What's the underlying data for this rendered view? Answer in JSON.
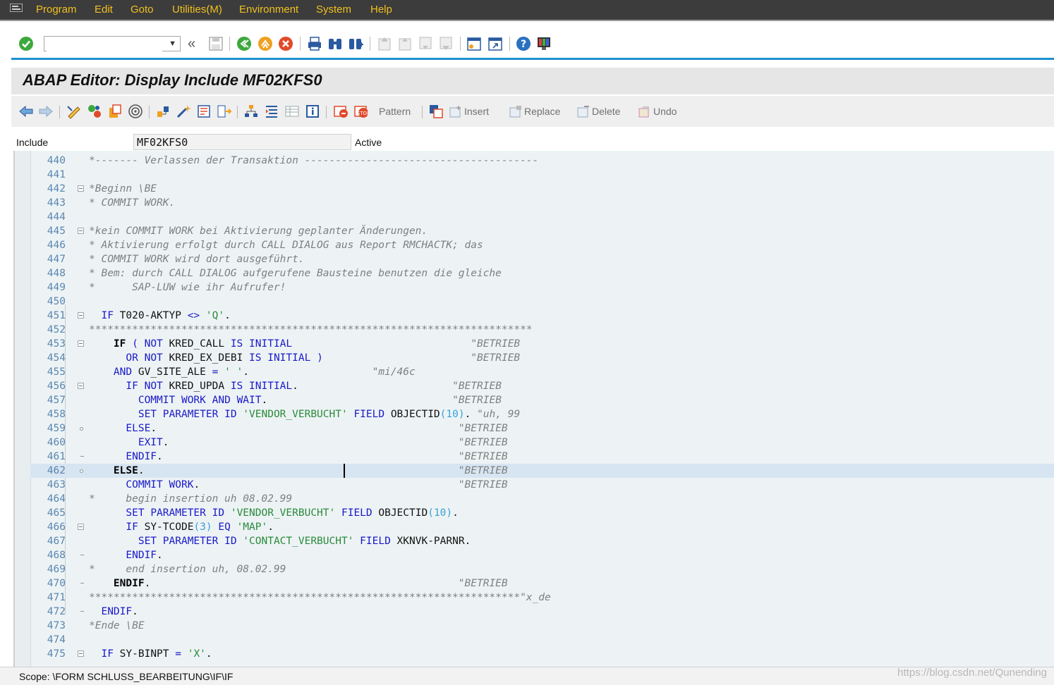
{
  "menu": {
    "items": [
      "Program",
      "Edit",
      "Goto",
      "Utilities(M)",
      "Environment",
      "System",
      "Help"
    ]
  },
  "toolbar": {
    "command_value": "",
    "command_placeholder": "",
    "expand_glyph": "«"
  },
  "title": "ABAP Editor: Display Include MF02KFS0",
  "app_toolbar": {
    "pattern": "Pattern",
    "insert": "Insert",
    "replace": "Replace",
    "delete": "Delete",
    "undo": "Undo"
  },
  "include": {
    "label": "Include",
    "value": "MF02KFS0",
    "status": "Active"
  },
  "editor": {
    "current_line": 462,
    "lines": [
      {
        "n": "440",
        "fold": "",
        "seg": [
          [
            "c",
            "*------- Verlassen der Transaktion --------------------------------------"
          ]
        ]
      },
      {
        "n": "441",
        "fold": "",
        "seg": []
      },
      {
        "n": "442",
        "fold": "box",
        "seg": [
          [
            "c",
            "*Beginn \\BE"
          ]
        ]
      },
      {
        "n": "443",
        "fold": "",
        "seg": [
          [
            "c",
            "* COMMIT WORK."
          ]
        ]
      },
      {
        "n": "444",
        "fold": "",
        "seg": []
      },
      {
        "n": "445",
        "fold": "box",
        "seg": [
          [
            "c",
            "*kein COMMIT WORK bei Aktivierung geplanter Änderungen."
          ]
        ]
      },
      {
        "n": "446",
        "fold": "",
        "seg": [
          [
            "c",
            "* Aktivierung erfolgt durch CALL DIALOG aus Report RMCHACTK; das"
          ]
        ]
      },
      {
        "n": "447",
        "fold": "",
        "seg": [
          [
            "c",
            "* COMMIT WORK wird dort ausgeführt."
          ]
        ]
      },
      {
        "n": "448",
        "fold": "",
        "seg": [
          [
            "c",
            "* Bem: durch CALL DIALOG aufgerufene Bausteine benutzen die gleiche"
          ]
        ]
      },
      {
        "n": "449",
        "fold": "",
        "seg": [
          [
            "c",
            "*      SAP-LUW wie ihr Aufrufer!"
          ]
        ]
      },
      {
        "n": "450",
        "fold": "",
        "seg": []
      },
      {
        "n": "451",
        "fold": "box",
        "seg": [
          [
            "p",
            "  "
          ],
          [
            "k",
            "IF"
          ],
          [
            "p",
            " T020-AKTYP "
          ],
          [
            "k",
            "<>"
          ],
          [
            "p",
            " "
          ],
          [
            "s",
            "'Q'"
          ],
          [
            "p",
            "."
          ]
        ]
      },
      {
        "n": "452",
        "fold": "",
        "seg": [
          [
            "c",
            "************************************************************************"
          ]
        ]
      },
      {
        "n": "453",
        "fold": "box",
        "seg": [
          [
            "p",
            "    "
          ],
          [
            "b",
            "IF"
          ],
          [
            "p",
            " "
          ],
          [
            "k",
            "("
          ],
          [
            "p",
            " "
          ],
          [
            "k",
            "NOT"
          ],
          [
            "p",
            " KRED_CALL "
          ],
          [
            "k",
            "IS"
          ],
          [
            "p",
            " "
          ],
          [
            "k",
            "INITIAL"
          ],
          [
            "p",
            "                             "
          ],
          [
            "c",
            "\"BETRIEB"
          ]
        ]
      },
      {
        "n": "454",
        "fold": "",
        "seg": [
          [
            "p",
            "      "
          ],
          [
            "k",
            "OR"
          ],
          [
            "p",
            " "
          ],
          [
            "k",
            "NOT"
          ],
          [
            "p",
            " KRED_EX_DEBI "
          ],
          [
            "k",
            "IS"
          ],
          [
            "p",
            " "
          ],
          [
            "k",
            "INITIAL"
          ],
          [
            "p",
            " "
          ],
          [
            "k",
            ")"
          ],
          [
            "p",
            "                        "
          ],
          [
            "c",
            "\"BETRIEB"
          ]
        ]
      },
      {
        "n": "455",
        "fold": "",
        "seg": [
          [
            "p",
            "    "
          ],
          [
            "k",
            "AND"
          ],
          [
            "p",
            " GV_SITE_ALE "
          ],
          [
            "k",
            "="
          ],
          [
            "p",
            " "
          ],
          [
            "s",
            "' '"
          ],
          [
            "p",
            ".                    "
          ],
          [
            "c",
            "\"mi/46c"
          ]
        ]
      },
      {
        "n": "456",
        "fold": "box",
        "seg": [
          [
            "p",
            "      "
          ],
          [
            "k",
            "IF"
          ],
          [
            "p",
            " "
          ],
          [
            "k",
            "NOT"
          ],
          [
            "p",
            " KRED_UPDA "
          ],
          [
            "k",
            "IS"
          ],
          [
            "p",
            " "
          ],
          [
            "k",
            "INITIAL"
          ],
          [
            "p",
            ".                         "
          ],
          [
            "c",
            "\"BETRIEB"
          ]
        ]
      },
      {
        "n": "457",
        "fold": "",
        "seg": [
          [
            "p",
            "        "
          ],
          [
            "k",
            "COMMIT"
          ],
          [
            "p",
            " "
          ],
          [
            "k",
            "WORK"
          ],
          [
            "p",
            " "
          ],
          [
            "k",
            "AND"
          ],
          [
            "p",
            " "
          ],
          [
            "k",
            "WAIT"
          ],
          [
            "p",
            ".                              "
          ],
          [
            "c",
            "\"BETRIEB"
          ]
        ]
      },
      {
        "n": "458",
        "fold": "",
        "seg": [
          [
            "p",
            "        "
          ],
          [
            "k",
            "SET"
          ],
          [
            "p",
            " "
          ],
          [
            "k",
            "PARAMETER"
          ],
          [
            "p",
            " "
          ],
          [
            "k",
            "ID"
          ],
          [
            "p",
            " "
          ],
          [
            "s",
            "'VENDOR_VERBUCHT'"
          ],
          [
            "p",
            " "
          ],
          [
            "k",
            "FIELD"
          ],
          [
            "p",
            " OBJECTID"
          ],
          [
            "n",
            "(10)"
          ],
          [
            "p",
            ". "
          ],
          [
            "c",
            "\"uh, 99"
          ]
        ]
      },
      {
        "n": "459",
        "fold": "dot",
        "seg": [
          [
            "p",
            "      "
          ],
          [
            "k",
            "ELSE"
          ],
          [
            "p",
            ".                                                 "
          ],
          [
            "c",
            "\"BETRIEB"
          ]
        ]
      },
      {
        "n": "460",
        "fold": "",
        "seg": [
          [
            "p",
            "        "
          ],
          [
            "k",
            "EXIT"
          ],
          [
            "p",
            ".                                               "
          ],
          [
            "c",
            "\"BETRIEB"
          ]
        ]
      },
      {
        "n": "461",
        "fold": "tick",
        "seg": [
          [
            "p",
            "      "
          ],
          [
            "k",
            "ENDIF"
          ],
          [
            "p",
            ".                                                "
          ],
          [
            "c",
            "\"BETRIEB"
          ]
        ]
      },
      {
        "n": "462",
        "fold": "dot",
        "seg": [
          [
            "p",
            "    "
          ],
          [
            "b",
            "ELSE"
          ],
          [
            "p",
            ".                                                   "
          ],
          [
            "c",
            "\"BETRIEB"
          ]
        ]
      },
      {
        "n": "463",
        "fold": "",
        "seg": [
          [
            "p",
            "      "
          ],
          [
            "k",
            "COMMIT"
          ],
          [
            "p",
            " "
          ],
          [
            "k",
            "WORK"
          ],
          [
            "p",
            ".                                          "
          ],
          [
            "c",
            "\"BETRIEB"
          ]
        ]
      },
      {
        "n": "464",
        "fold": "",
        "seg": [
          [
            "c",
            "*     begin insertion uh 08.02.99"
          ]
        ]
      },
      {
        "n": "465",
        "fold": "",
        "seg": [
          [
            "p",
            "      "
          ],
          [
            "k",
            "SET"
          ],
          [
            "p",
            " "
          ],
          [
            "k",
            "PARAMETER"
          ],
          [
            "p",
            " "
          ],
          [
            "k",
            "ID"
          ],
          [
            "p",
            " "
          ],
          [
            "s",
            "'VENDOR_VERBUCHT'"
          ],
          [
            "p",
            " "
          ],
          [
            "k",
            "FIELD"
          ],
          [
            "p",
            " OBJECTID"
          ],
          [
            "n",
            "(10)"
          ],
          [
            "p",
            "."
          ]
        ]
      },
      {
        "n": "466",
        "fold": "box",
        "seg": [
          [
            "p",
            "      "
          ],
          [
            "k",
            "IF"
          ],
          [
            "p",
            " SY-TCODE"
          ],
          [
            "n",
            "(3)"
          ],
          [
            "p",
            " "
          ],
          [
            "k",
            "EQ"
          ],
          [
            "p",
            " "
          ],
          [
            "s",
            "'MAP'"
          ],
          [
            "p",
            "."
          ]
        ]
      },
      {
        "n": "467",
        "fold": "",
        "seg": [
          [
            "p",
            "        "
          ],
          [
            "k",
            "SET"
          ],
          [
            "p",
            " "
          ],
          [
            "k",
            "PARAMETER"
          ],
          [
            "p",
            " "
          ],
          [
            "k",
            "ID"
          ],
          [
            "p",
            " "
          ],
          [
            "s",
            "'CONTACT_VERBUCHT'"
          ],
          [
            "p",
            " "
          ],
          [
            "k",
            "FIELD"
          ],
          [
            "p",
            " XKNVK-PARNR."
          ]
        ]
      },
      {
        "n": "468",
        "fold": "tick",
        "seg": [
          [
            "p",
            "      "
          ],
          [
            "k",
            "ENDIF"
          ],
          [
            "p",
            "."
          ]
        ]
      },
      {
        "n": "469",
        "fold": "",
        "seg": [
          [
            "c",
            "*     end insertion uh, 08.02.99"
          ]
        ]
      },
      {
        "n": "470",
        "fold": "tick",
        "seg": [
          [
            "p",
            "    "
          ],
          [
            "b",
            "ENDIF"
          ],
          [
            "p",
            ".                                                  "
          ],
          [
            "c",
            "\"BETRIEB"
          ]
        ]
      },
      {
        "n": "471",
        "fold": "",
        "seg": [
          [
            "c",
            "**********************************************************************\"x_de"
          ]
        ]
      },
      {
        "n": "472",
        "fold": "tick",
        "seg": [
          [
            "p",
            "  "
          ],
          [
            "k",
            "ENDIF"
          ],
          [
            "p",
            "."
          ]
        ]
      },
      {
        "n": "473",
        "fold": "",
        "seg": [
          [
            "c",
            "*Ende \\BE"
          ]
        ]
      },
      {
        "n": "474",
        "fold": "",
        "seg": []
      },
      {
        "n": "475",
        "fold": "box",
        "seg": [
          [
            "p",
            "  "
          ],
          [
            "k",
            "IF"
          ],
          [
            "p",
            " SY-BINPT "
          ],
          [
            "k",
            "="
          ],
          [
            "p",
            " "
          ],
          [
            "s",
            "'X'"
          ],
          [
            "p",
            "."
          ]
        ]
      }
    ]
  },
  "status": {
    "scope": "Scope: \\FORM SCHLUSS_BEARBEITUNG\\IF\\IF",
    "watermark": "https://blog.csdn.net/Qunending"
  },
  "colors": {
    "menu_text": "#f0c020",
    "accent_line": "#1e8fd0",
    "keyword": "#1919c8",
    "string": "#2a8a3a",
    "comment": "#7f7f7f",
    "current_line": "#d7e5f2"
  }
}
